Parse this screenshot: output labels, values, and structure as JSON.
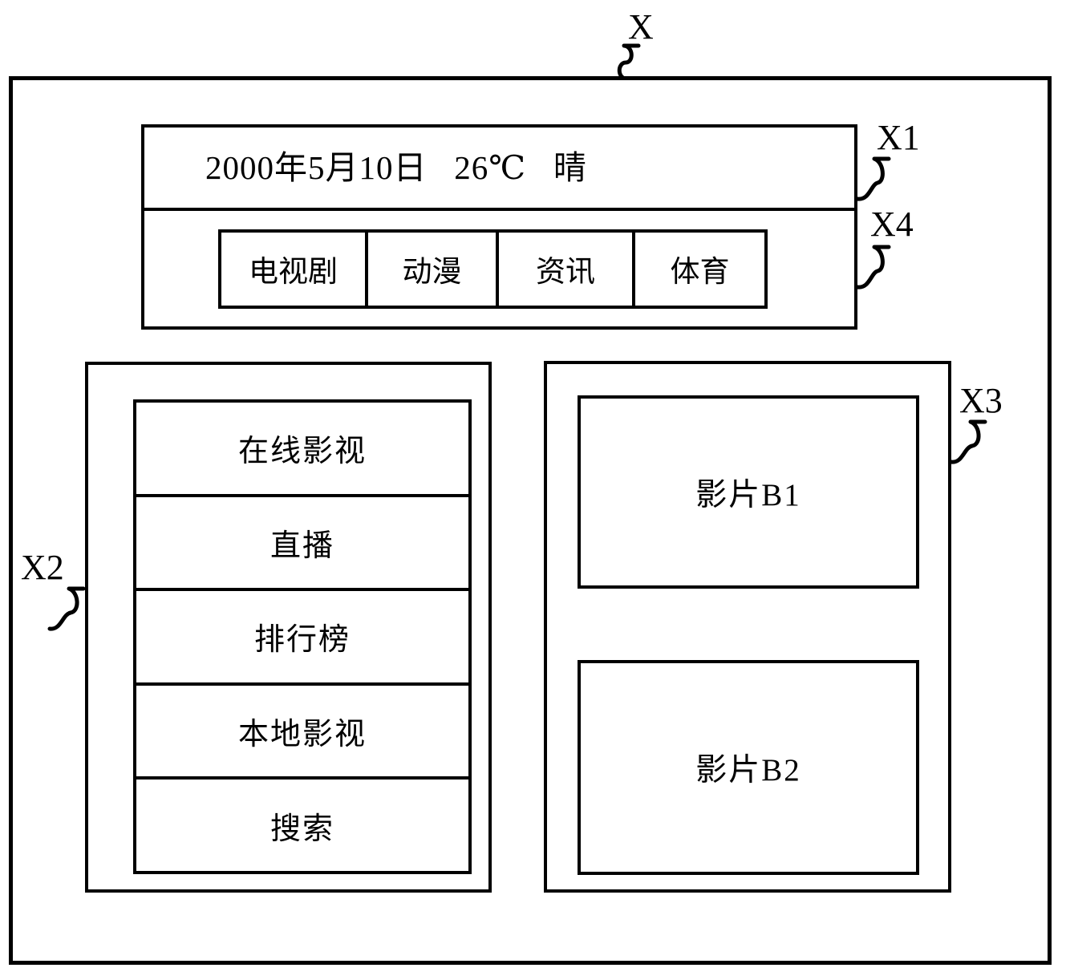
{
  "figure": {
    "type": "ui-layout-schematic",
    "reference_labels": {
      "device": "X",
      "status_bar": "X1",
      "tab_bar": "X4",
      "left_panel": "X2",
      "right_panel": "X3"
    }
  },
  "status_bar": {
    "text": "2000年5月10日   26℃   晴",
    "date": "2000年5月10日",
    "temperature": "26℃",
    "weather": "晴"
  },
  "tab_bar": {
    "tabs": [
      {
        "label": "电视剧"
      },
      {
        "label": "动漫"
      },
      {
        "label": "资讯"
      },
      {
        "label": "体育"
      }
    ]
  },
  "left_panel": {
    "menu_items": [
      {
        "label": "在线影视"
      },
      {
        "label": "直播"
      },
      {
        "label": "排行榜"
      },
      {
        "label": "本地影视"
      },
      {
        "label": "搜索"
      }
    ]
  },
  "right_panel": {
    "media_items": [
      {
        "label": "影片B1"
      },
      {
        "label": "影片B2"
      }
    ]
  },
  "colors": {
    "stroke": "#000000",
    "background": "#ffffff"
  }
}
